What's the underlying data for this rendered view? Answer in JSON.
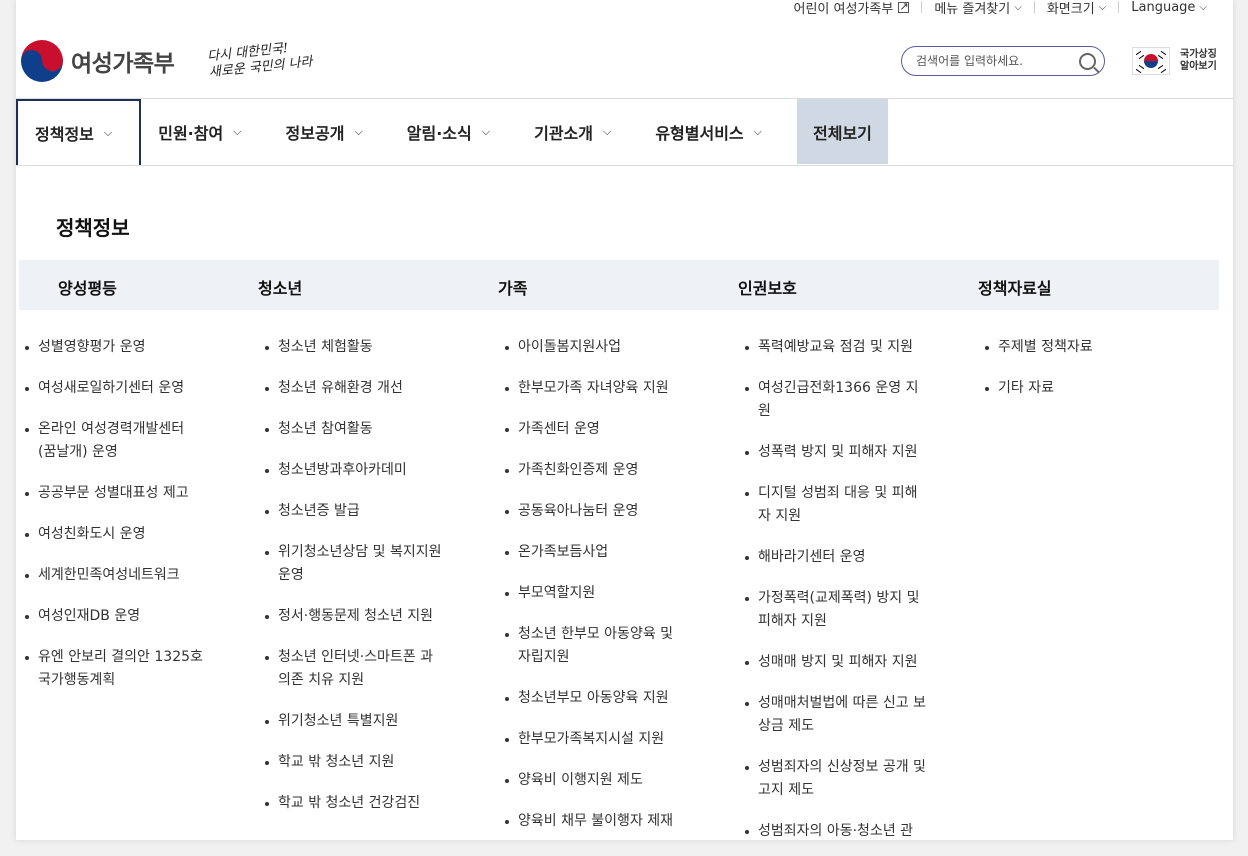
{
  "utility": {
    "items": [
      {
        "label": "어린이 여성가족부",
        "icon": "external-link-icon"
      },
      {
        "label": "메뉴 즐겨찾기",
        "icon": "chevron-down-icon"
      },
      {
        "label": "화면크기",
        "icon": "chevron-down-icon"
      },
      {
        "label": "Language",
        "icon": "chevron-down-icon"
      }
    ]
  },
  "header": {
    "ministry_name": "여성가족부",
    "slogan_line1": "다시 대한민국!",
    "slogan_line2": "새로운 국민의 나라",
    "search_placeholder": "검색어를 입력하세요.",
    "national_symbol_line1": "국가상징",
    "national_symbol_line2": "알아보기"
  },
  "nav": {
    "items": [
      {
        "label": "정책정보",
        "active": true
      },
      {
        "label": "민원·참여"
      },
      {
        "label": "정보공개"
      },
      {
        "label": "알림·소식"
      },
      {
        "label": "기관소개"
      },
      {
        "label": "유형별서비스"
      }
    ],
    "all_label": "전체보기"
  },
  "mega": {
    "title": "정책정보",
    "columns": [
      {
        "category": "양성평등",
        "items": [
          "성별영향평가 운영",
          "여성새로일하기센터 운영",
          "온라인 여성경력개발센터 (꿈날개) 운영",
          "공공부문 성별대표성 제고",
          "여성친화도시 운영",
          "세계한민족여성네트워크",
          "여성인재DB 운영",
          "유엔 안보리 결의안 1325호 국가행동계획"
        ]
      },
      {
        "category": "청소년",
        "items": [
          "청소년 체험활동",
          "청소년 유해환경 개선",
          "청소년 참여활동",
          "청소년방과후아카데미",
          "청소년증 발급",
          "위기청소년상담 및 복지지원 운영",
          "정서·행동문제 청소년 지원",
          "청소년 인터넷·스마트폰 과의존 치유 지원",
          "위기청소년 특별지원",
          "학교 밖 청소년 지원",
          "학교 밖 청소년 건강검진"
        ]
      },
      {
        "category": "가족",
        "items": [
          "아이돌봄지원사업",
          "한부모가족 자녀양육 지원",
          "가족센터 운영",
          "가족친화인증제 운영",
          "공동육아나눔터 운영",
          "온가족보듬사업",
          "부모역할지원",
          "청소년 한부모 아동양육 및 자립지원",
          "청소년부모 아동양육 지원",
          "한부모가족복지시설 지원",
          "양육비 이행지원 제도",
          "양육비 채무 불이행자 제재"
        ]
      },
      {
        "category": "인권보호",
        "items": [
          "폭력예방교육 점검 및 지원",
          "여성긴급전화1366 운영 지원",
          "성폭력 방지 및 피해자 지원",
          "디지털 성범죄 대응 및 피해자 지원",
          "해바라기센터 운영",
          "가정폭력(교제폭력) 방지 및 피해자 지원",
          "성매매 방지 및 피해자 지원",
          "성매매처벌법에 따른 신고 보상금 제도",
          "성범죄자의 신상정보 공개 및 고지 제도",
          "성범죄자의 아동·청소년 관"
        ]
      },
      {
        "category": "정책자료실",
        "items": [
          "주제별 정책자료",
          "기타 자료"
        ]
      }
    ]
  }
}
